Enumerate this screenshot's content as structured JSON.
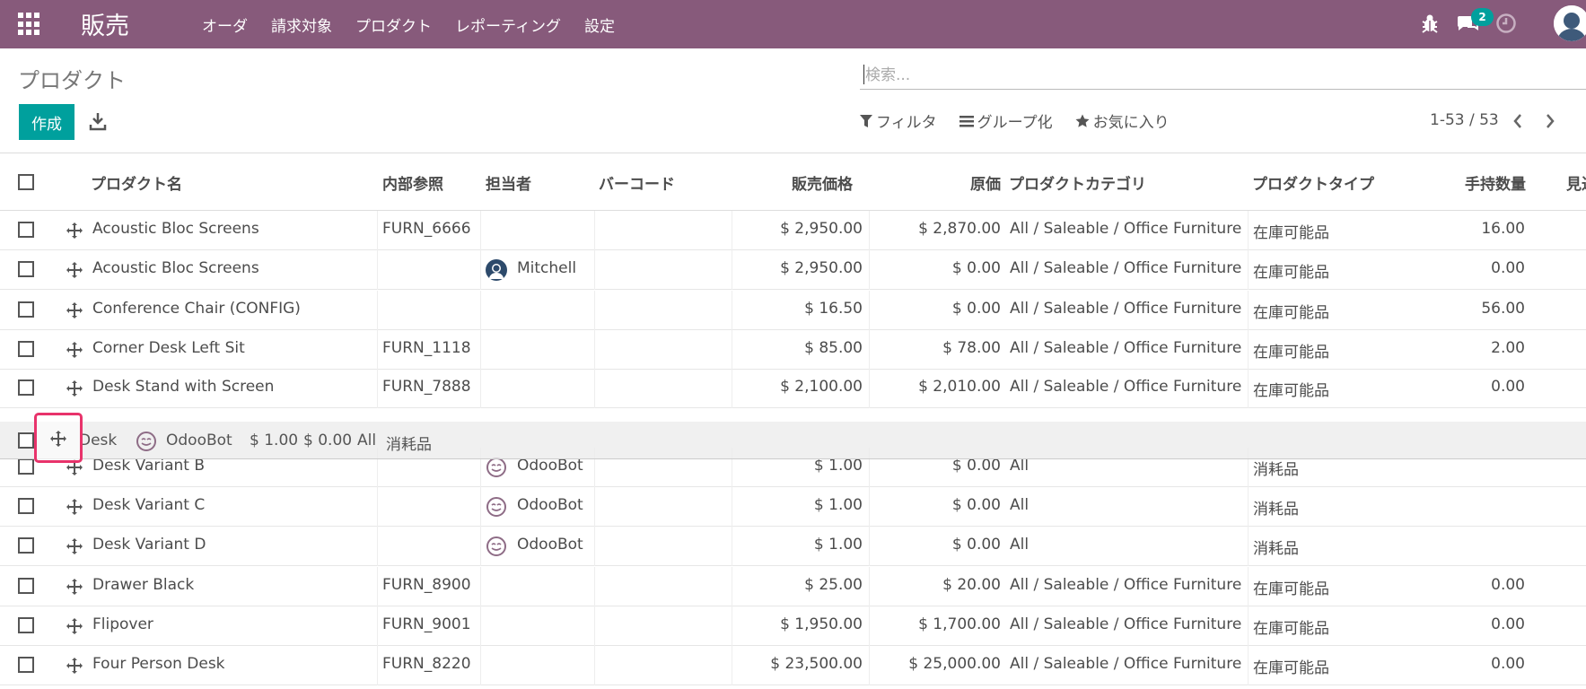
{
  "nav": {
    "app_title": "販売",
    "menu": [
      "オーダ",
      "請求対象",
      "プロダクト",
      "レポーティング",
      "設定"
    ],
    "chat_count": "2"
  },
  "control": {
    "page_title": "プロダクト",
    "create_label": "作成",
    "search_placeholder": "検索...",
    "filter_label": "フィルタ",
    "group_label": "グループ化",
    "favorites_label": "お気に入り",
    "pager_text": "1-53 / 53"
  },
  "table": {
    "headers": {
      "name": "プロダクト名",
      "ref": "内部参照",
      "responsible": "担当者",
      "barcode": "バーコード",
      "price": "販売価格",
      "cost": "原価",
      "category": "プロダクトカテゴリ",
      "type": "プロダクトタイプ",
      "qty": "手持数量",
      "forecast": "見込"
    },
    "rows": [
      {
        "name": "Acoustic Bloc Screens",
        "ref": "FURN_6666",
        "responsible": "",
        "price": "$ 2,950.00",
        "cost": "$ 2,870.00",
        "category": "All / Saleable / Office Furniture",
        "type": "在庫可能品",
        "qty": "16.00"
      },
      {
        "name": "Acoustic Bloc Screens",
        "ref": "",
        "responsible": "Mitchell",
        "price": "$ 2,950.00",
        "cost": "$ 0.00",
        "category": "All / Saleable / Office Furniture",
        "type": "在庫可能品",
        "qty": "0.00"
      },
      {
        "name": "Conference Chair (CONFIG)",
        "ref": "",
        "responsible": "",
        "price": "$ 16.50",
        "cost": "$ 0.00",
        "category": "All / Saleable / Office Furniture",
        "type": "在庫可能品",
        "qty": "56.00"
      },
      {
        "name": "Corner Desk Left Sit",
        "ref": "FURN_1118",
        "responsible": "",
        "price": "$ 85.00",
        "cost": "$ 78.00",
        "category": "All / Saleable / Office Furniture",
        "type": "在庫可能品",
        "qty": "2.00"
      },
      {
        "name": "Desk Stand with Screen",
        "ref": "FURN_7888",
        "responsible": "",
        "price": "$ 2,100.00",
        "cost": "$ 2,010.00",
        "category": "All / Saleable / Office Furniture",
        "type": "在庫可能品",
        "qty": "0.00"
      },
      {
        "name": "Desk Variant B",
        "ref": "",
        "responsible": "OdooBot",
        "price": "$ 1.00",
        "cost": "$ 0.00",
        "category": "All",
        "type": "消耗品",
        "qty": ""
      },
      {
        "name": "Desk Variant C",
        "ref": "",
        "responsible": "OdooBot",
        "price": "$ 1.00",
        "cost": "$ 0.00",
        "category": "All",
        "type": "消耗品",
        "qty": ""
      },
      {
        "name": "Desk Variant D",
        "ref": "",
        "responsible": "OdooBot",
        "price": "$ 1.00",
        "cost": "$ 0.00",
        "category": "All",
        "type": "消耗品",
        "qty": ""
      },
      {
        "name": "Drawer Black",
        "ref": "FURN_8900",
        "responsible": "",
        "price": "$ 25.00",
        "cost": "$ 20.00",
        "category": "All / Saleable / Office Furniture",
        "type": "在庫可能品",
        "qty": "0.00"
      },
      {
        "name": "Flipover",
        "ref": "FURN_9001",
        "responsible": "",
        "price": "$ 1,950.00",
        "cost": "$ 1,700.00",
        "category": "All / Saleable / Office Furniture",
        "type": "在庫可能品",
        "qty": "0.00"
      },
      {
        "name": "Four Person Desk",
        "ref": "FURN_8220",
        "responsible": "",
        "price": "$ 23,500.00",
        "cost": "$ 25,000.00",
        "category": "All / Saleable / Office Furniture",
        "type": "在庫可能品",
        "qty": "0.00"
      }
    ],
    "dragging_row": {
      "name": "Desk",
      "responsible": "OdooBot",
      "price": "$ 1.00",
      "cost": "$ 0.00",
      "category": "All",
      "type": "消耗品"
    }
  },
  "colors": {
    "navbar": "#875a7b",
    "accent": "#00a09d",
    "highlight": "#e8336b"
  }
}
